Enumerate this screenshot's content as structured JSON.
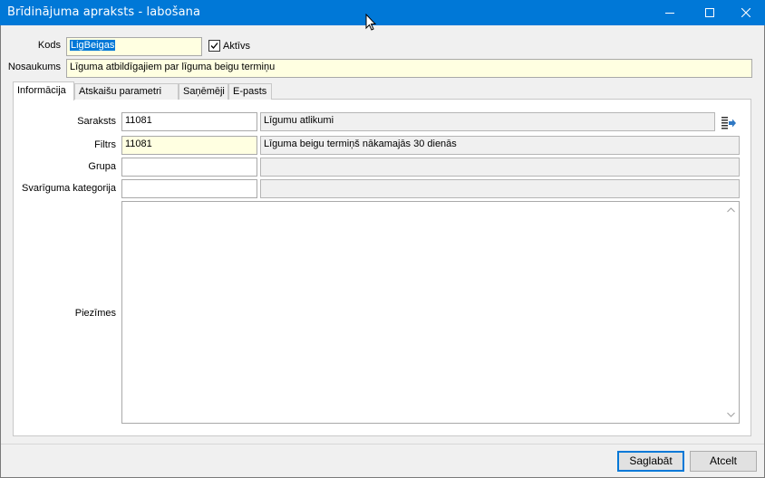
{
  "window": {
    "title": "Brīdinājuma apraksts - labošana"
  },
  "header": {
    "kods_label": "Kods",
    "kods_value": "LigBeigas",
    "aktivs_label": "Aktīvs",
    "aktivs_checked": true,
    "nosaukums_label": "Nosaukums",
    "nosaukums_value": "Līguma atbildīgajiem par līguma beigu termiņu"
  },
  "tabs": [
    {
      "label": "Informācija",
      "active": true
    },
    {
      "label": "Atskaišu parametri",
      "active": false
    },
    {
      "label": "Saņēmēji",
      "active": false
    },
    {
      "label": "E-pasts",
      "active": false
    }
  ],
  "form": {
    "saraksts_label": "Saraksts",
    "saraksts_code": "11081",
    "saraksts_name": "Līgumu atlikumi",
    "filtrs_label": "Filtrs",
    "filtrs_code": "11081",
    "filtrs_name": "Līguma beigu termiņš nākamajās 30 dienās",
    "grupa_label": "Grupa",
    "grupa_code": "",
    "grupa_name": "",
    "svariguma_label": "Svarīguma kategorija",
    "svariguma_code": "",
    "svariguma_name": "",
    "piezimes_label": "Piezīmes",
    "piezimes_value": ""
  },
  "buttons": {
    "save": "Saglabāt",
    "cancel": "Atcelt"
  },
  "colors": {
    "titlebar": "#0078d7",
    "required_field": "#ffffe1",
    "selection": "#0078d7"
  }
}
